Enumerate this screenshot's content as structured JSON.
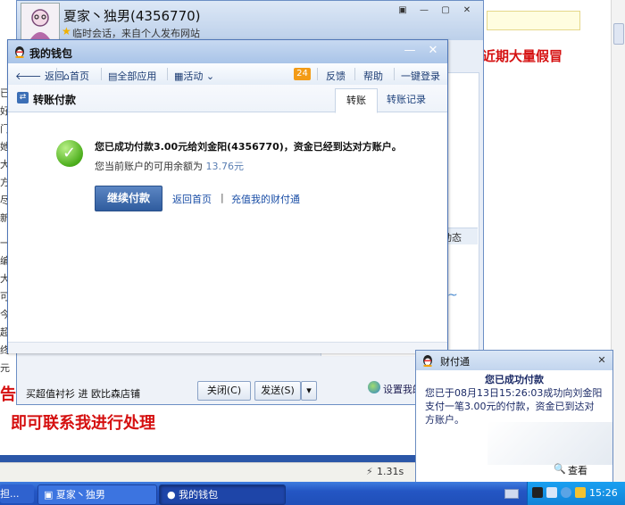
{
  "background_page": {
    "right_headline": "近期大量假冒",
    "bottom_headline": "即可联系我进行处理",
    "left_red_fragment": "告扫",
    "left_fragments": [
      "已",
      "好",
      "门",
      "她",
      "大",
      "方",
      "尽",
      "新",
      "一",
      "编",
      "大",
      "可",
      "今",
      "超",
      "终",
      "元"
    ],
    "status_time": "1.31s",
    "status_zoom": "—"
  },
  "chat_window": {
    "title": "夏家丶独男(4356770)",
    "subtitle": "临时会话，来自个人发布网站",
    "shop_text": "买超值衬衫 进 欧比森店铺",
    "close_button": "关闭(C)",
    "send_button": "发送(S)",
    "settings_text": "设置我的QQ",
    "right_tab": "动态",
    "tilde": "~"
  },
  "wallet": {
    "title": "我的钱包",
    "nav": {
      "back": "返回",
      "home": "首页",
      "apps": "全部应用",
      "activity": "活动",
      "badge": "24",
      "feedback": "反馈",
      "help": "帮助",
      "login": "一键登录"
    },
    "section_title": "转账付款",
    "tabs": [
      "转账",
      "转账记录"
    ],
    "success_message": "您已成功付款3.00元给刘金阳(4356770)，资金已经到达对方账户。",
    "balance_prefix": "您当前账户的可用余额为",
    "balance_value": "13.76元",
    "continue_button": "继续付款",
    "link_home": "返回首页",
    "link_separator": "|",
    "link_recharge": "充值我的财付通"
  },
  "tenpay_popup": {
    "name": "财付通",
    "title": "您已成功付款",
    "body": "您已于08月13日15:26:03成功向刘金阳支付一笔3.00元的付款，资金已到达对方账户。",
    "view_button": "查看"
  },
  "taskbar": {
    "task_1": "担...",
    "task_2": "夏家丶独男",
    "task_3": "我的钱包",
    "clock": "15:26"
  },
  "colors": {
    "accent": "#2f5c9e",
    "link": "#1a4ea6",
    "success": "#4cae1c",
    "warning_badge": "#f39b16",
    "headline_red": "#d51010"
  }
}
